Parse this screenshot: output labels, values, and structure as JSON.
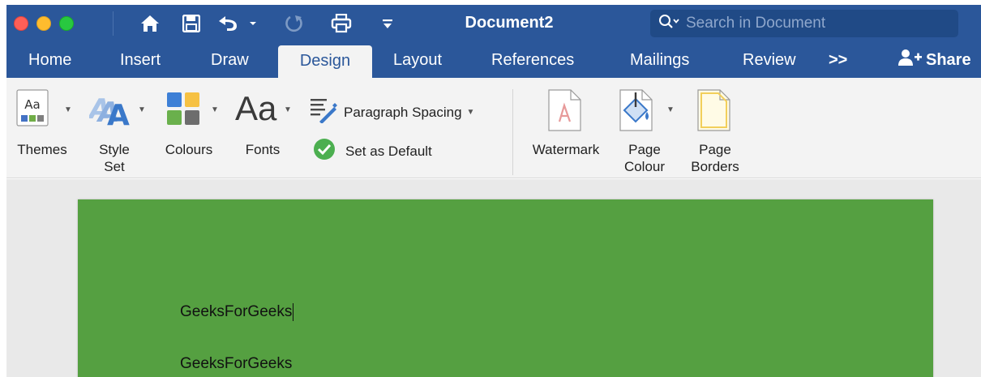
{
  "window": {
    "title": "Document2",
    "search_placeholder": "Search in Document"
  },
  "quick_access": {
    "icons": [
      "home-icon",
      "save-icon",
      "undo-icon",
      "redo-icon",
      "print-icon",
      "customize-icon"
    ]
  },
  "tabs": [
    {
      "label": "Home"
    },
    {
      "label": "Insert"
    },
    {
      "label": "Draw"
    },
    {
      "label": "Design",
      "active": true
    },
    {
      "label": "Layout"
    },
    {
      "label": "References"
    },
    {
      "label": "Mailings"
    },
    {
      "label": "Review"
    }
  ],
  "more_tabs_label": ">>",
  "share_label": "Share",
  "ribbon": {
    "themes": "Themes",
    "style_set_line1": "Style",
    "style_set_line2": "Set",
    "colours": "Colours",
    "fonts": "Fonts",
    "fonts_icon_text": "Aa",
    "themes_icon_text": "Aa",
    "paragraph_spacing": "Paragraph Spacing",
    "set_as_default": "Set as Default",
    "watermark": "Watermark",
    "page_colour_line1": "Page",
    "page_colour_line2": "Colour",
    "page_borders_line1": "Page",
    "page_borders_line2": "Borders"
  },
  "document": {
    "page_color": "#55a041",
    "lines": [
      "GeeksForGeeks",
      "GeeksForGeeks"
    ]
  },
  "colors": {
    "brand": "#2b579a",
    "ribbon_bg": "#f3f3f3"
  }
}
